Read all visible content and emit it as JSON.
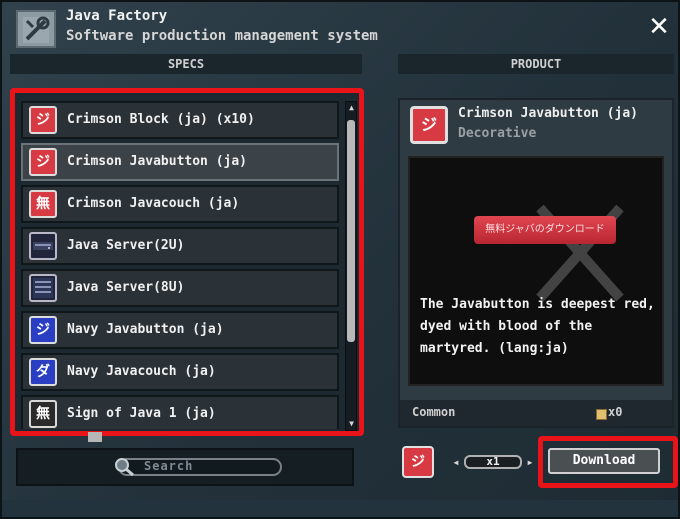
{
  "window": {
    "title": "Java Factory",
    "subtitle": "Software production management system",
    "close_label": "✕"
  },
  "specs": {
    "header": "SPECS",
    "items": [
      {
        "label": "Crimson Block (ja) (x10)",
        "icon": "crimson-block-icon",
        "glyph": "ジ"
      },
      {
        "label": "Crimson Javabutton (ja)",
        "icon": "crimson-javabutton-icon",
        "glyph": "ジ",
        "selected": true
      },
      {
        "label": "Crimson Javacouch (ja)",
        "icon": "crimson-javacouch-icon",
        "glyph": "無"
      },
      {
        "label": "Java Server(2U)",
        "icon": "server-2u-icon",
        "glyph": ""
      },
      {
        "label": "Java Server(8U)",
        "icon": "server-8u-icon",
        "glyph": ""
      },
      {
        "label": "Navy Javabutton (ja)",
        "icon": "navy-javabutton-icon",
        "glyph": "ジ"
      },
      {
        "label": "Navy Javacouch (ja)",
        "icon": "navy-javacouch-icon",
        "glyph": "ダ"
      },
      {
        "label": "Sign of Java 1 (ja)",
        "icon": "sign-icon",
        "glyph": "無"
      }
    ]
  },
  "search": {
    "placeholder": "Search"
  },
  "product": {
    "header": "PRODUCT",
    "name": "Crimson Javabutton (ja)",
    "type": "Decorative",
    "icon_glyph": "ジ",
    "preview_button": "無料ジャバのダウンロード",
    "description": "The Javabutton is deepest red, dyed with blood of the martyred. (lang:ja)",
    "rarity_label": "Common",
    "cost": "x0"
  },
  "order": {
    "quantity": "x1",
    "download_label": "Download",
    "decrease": "◂",
    "increase": "▸"
  },
  "colors": {
    "highlight_red": "#e8141a",
    "crimson": "#d83a44",
    "navy": "#2a3ec4"
  }
}
